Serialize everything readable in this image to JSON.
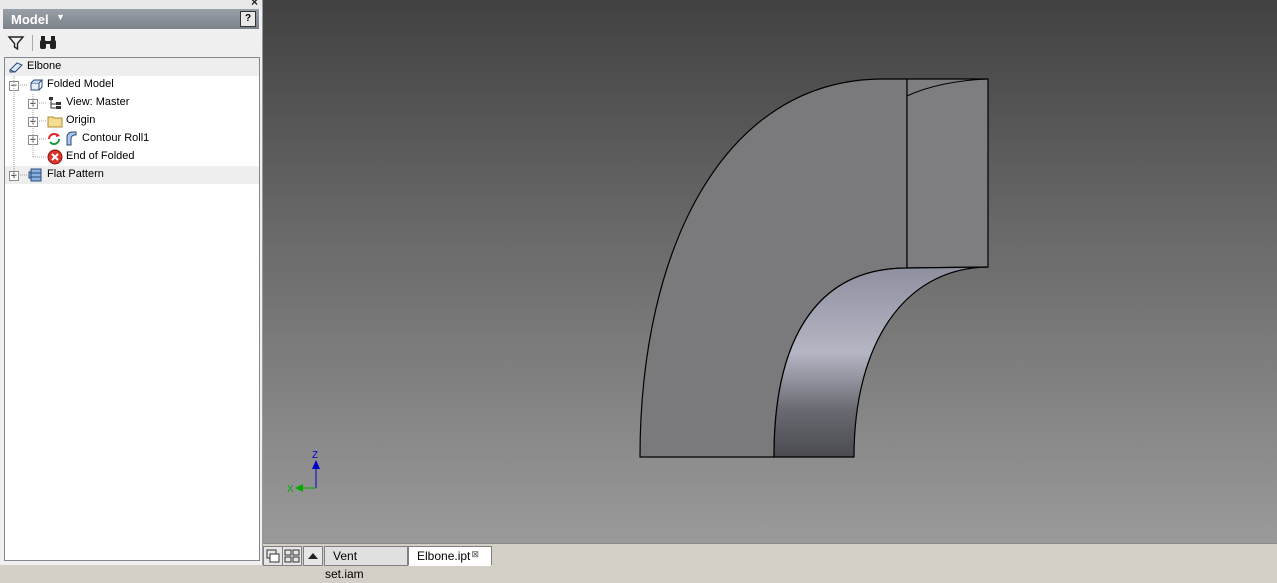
{
  "panel": {
    "title": "Model",
    "help_label": "?",
    "close_label": "×"
  },
  "tree": {
    "root": {
      "label": "Elbone",
      "icon": "part-icon"
    },
    "items": [
      {
        "label": "Folded Model",
        "icon": "folded-model-icon"
      },
      {
        "label": "View: Master",
        "icon": "view-icon"
      },
      {
        "label": "Origin",
        "icon": "folder-icon"
      },
      {
        "label": "Contour Roll1",
        "icon": "contour-roll-icon"
      },
      {
        "label": "End of Folded",
        "icon": "end-of-folded-icon"
      },
      {
        "label": "Flat Pattern",
        "icon": "flat-pattern-icon"
      }
    ]
  },
  "viewcube": {
    "z_label": "Z",
    "x_label": "X"
  },
  "tabs": [
    {
      "label": "Vent set.iam",
      "active": false
    },
    {
      "label": "Elbone.ipt",
      "active": true,
      "close": "⊠"
    }
  ],
  "colors": {
    "face": "#7a7a7d",
    "accent_highlight": "#b4b6c4",
    "axis_z": "#0000cc",
    "axis_x": "#00aa00"
  }
}
